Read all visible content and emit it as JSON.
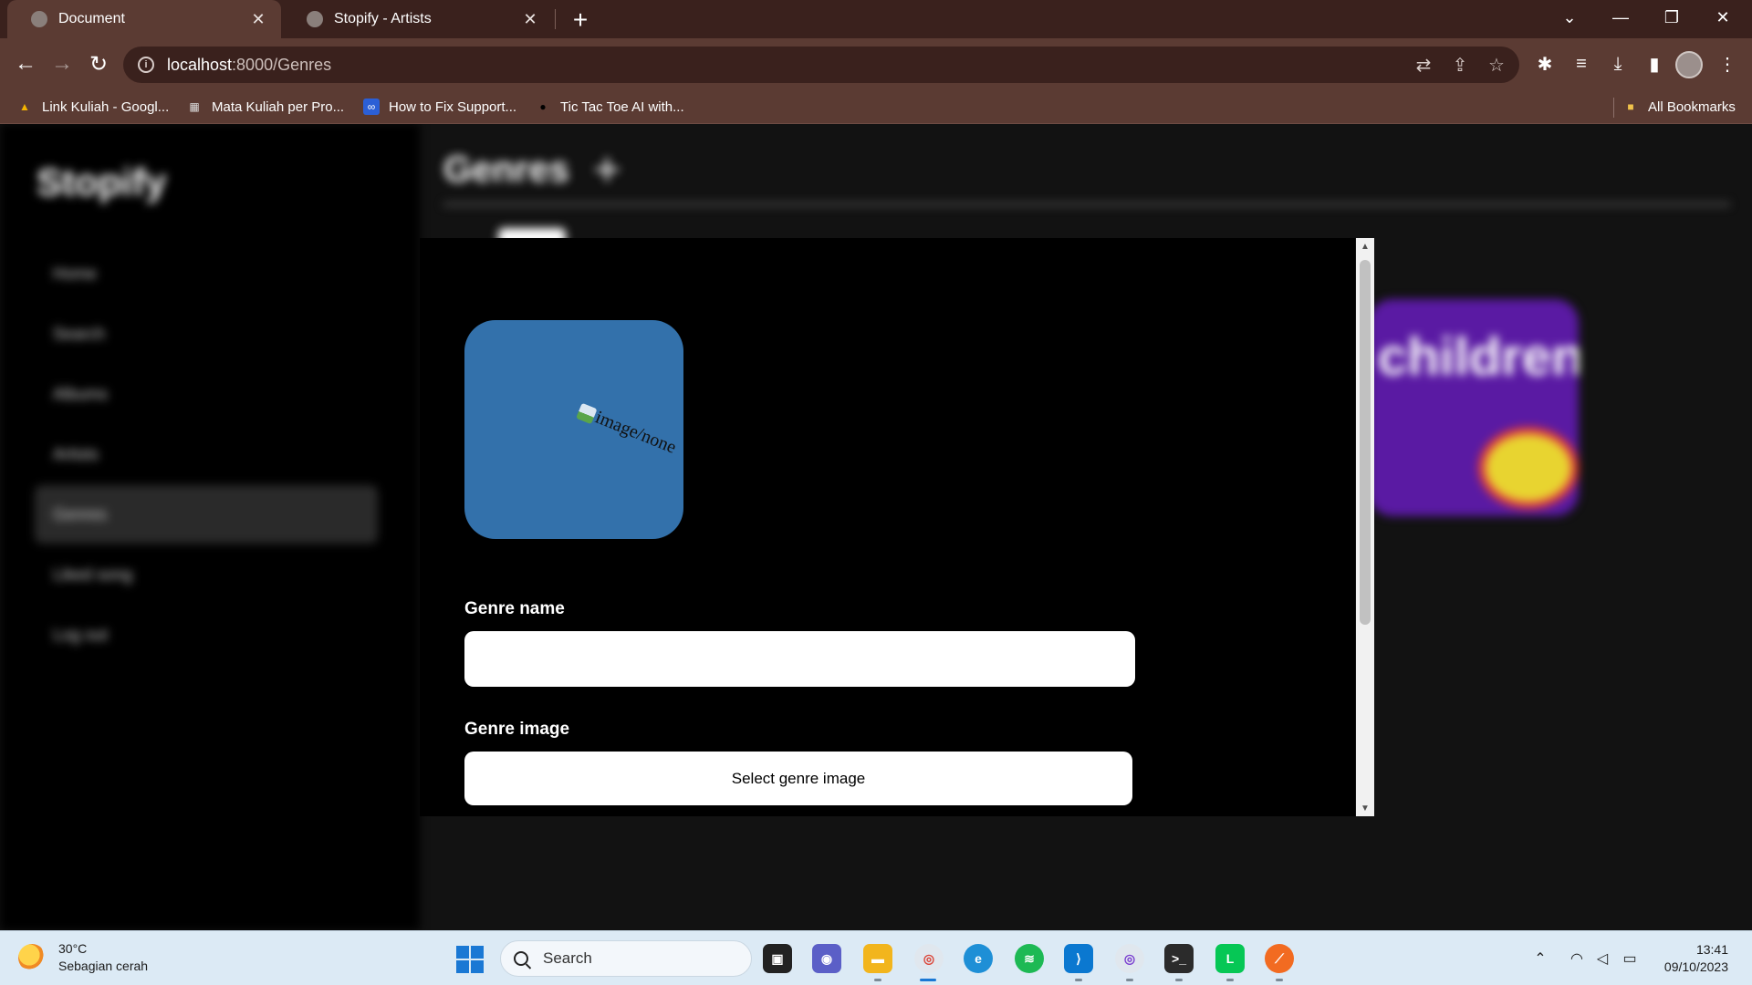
{
  "browser": {
    "tabs": [
      {
        "title": "Document",
        "active": true
      },
      {
        "title": "Stopify - Artists",
        "active": false
      }
    ],
    "new_tab": "+",
    "window_controls": {
      "dropdown": "⌄",
      "minimize": "—",
      "restore": "❐",
      "close": "✕"
    },
    "url_host": "localhost",
    "url_path": ":8000/Genres",
    "bookmarks": [
      {
        "label": "Link Kuliah - Googl...",
        "icon": "google-drive-icon"
      },
      {
        "label": "Mata Kuliah per Pro...",
        "icon": "book-icon"
      },
      {
        "label": "How to Fix Support...",
        "icon": "infinity-icon"
      },
      {
        "label": "Tic Tac Toe AI with...",
        "icon": "circle-icon"
      }
    ],
    "all_bookmarks": "All Bookmarks"
  },
  "page": {
    "brand": "Stopify",
    "sidebar": [
      "Home",
      "Search",
      "Albums",
      "Artists",
      "Genres",
      "Liked song",
      "Log out"
    ],
    "active_sidebar": "Genres",
    "main_title": "Genres",
    "genre_card_text": "children"
  },
  "modal": {
    "preview_alt": "image/none",
    "name_label": "Genre name",
    "name_value": "",
    "image_label": "Genre image",
    "image_button": "Select genre image"
  },
  "taskbar": {
    "temperature": "30°C",
    "weather": "Sebagian cerah",
    "search_placeholder": "Search",
    "time": "13:41",
    "date": "09/10/2023"
  },
  "colors": {
    "chrome_dark": "#3a211d",
    "chrome": "#5b3b33",
    "preview_bg": "#3371ab",
    "genre_card": "#5a1aa3"
  }
}
